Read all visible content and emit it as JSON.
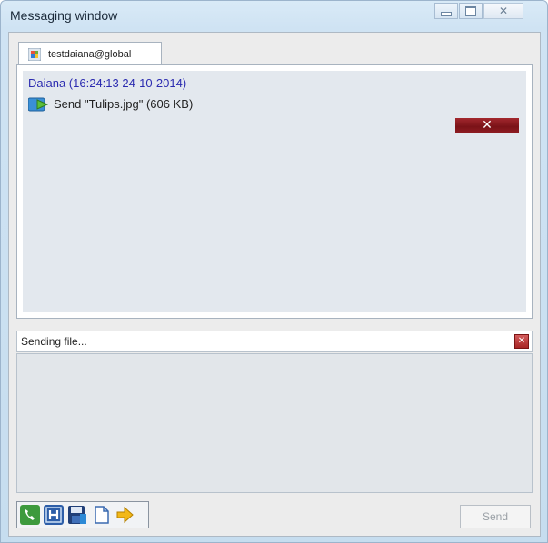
{
  "window": {
    "title": "Messaging window"
  },
  "tab": {
    "label": "testdaiana@global"
  },
  "chat": {
    "messages": [
      {
        "header": "Daiana (16:24:13 24-10-2014)",
        "text": "Send \"Tulips.jpg\" (606 KB)"
      }
    ]
  },
  "status": {
    "text": "Sending file..."
  },
  "toolbar": {
    "send_label": "Send",
    "icons": [
      "phone-icon",
      "h-icon",
      "save-icon",
      "document-icon",
      "arrow-right-icon"
    ]
  },
  "colors": {
    "message_header": "#2b2bb0",
    "cancel_button": "#8e1c22",
    "chat_bg": "#e3e8ee"
  }
}
